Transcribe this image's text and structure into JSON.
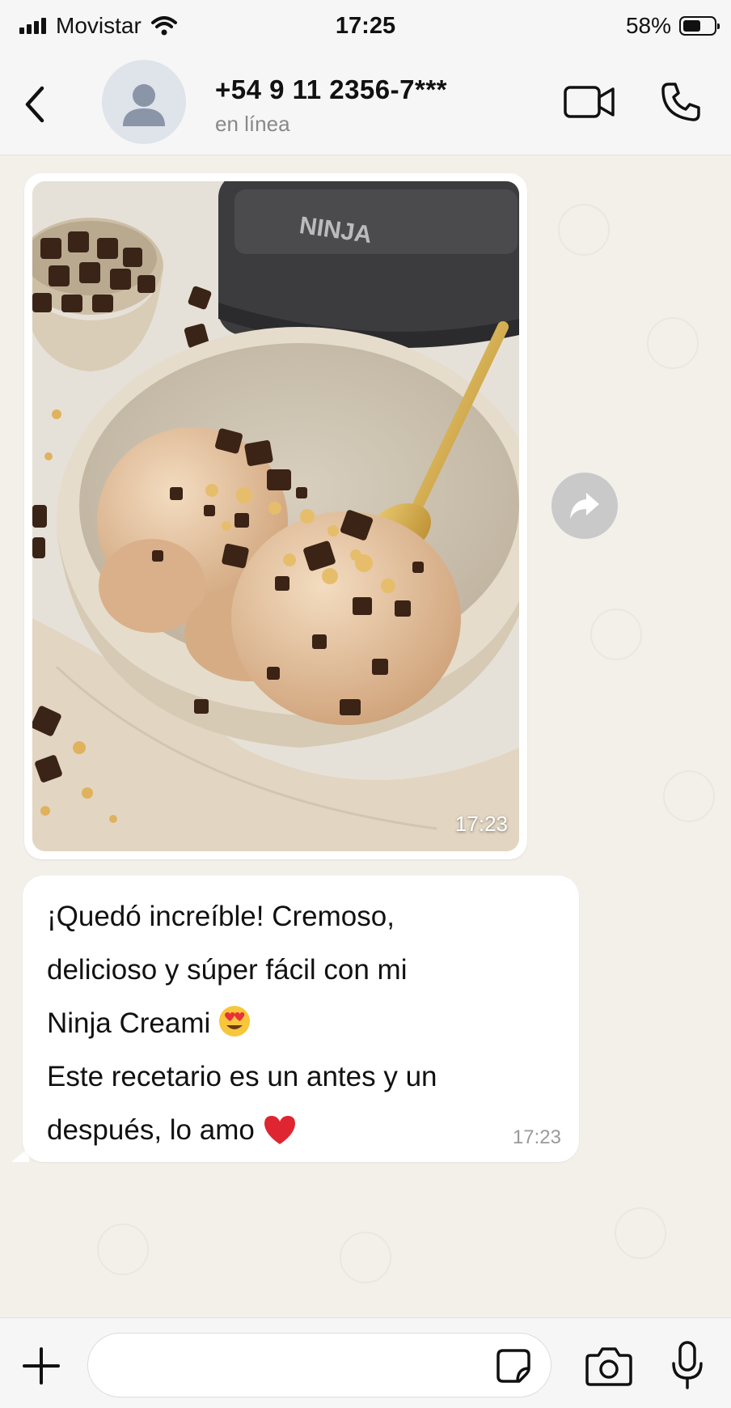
{
  "status_bar": {
    "carrier": "Movistar",
    "time": "17:25",
    "battery": "58%",
    "battery_level": 0.58
  },
  "header": {
    "contact_name": "+54 9 11 2356-7***",
    "contact_status": "en línea"
  },
  "image_message": {
    "time": "17:23",
    "brand_text": "NINJA"
  },
  "text_message": {
    "line1": "¡Quedó increíble! Cremoso,",
    "line2": "delicioso y súper fácil con mi",
    "line3": "Ninja Creami ",
    "line4": "Este recetario es un antes y un",
    "line5": "después, lo amo ",
    "time": "17:23"
  },
  "input": {
    "placeholder": ""
  },
  "icons": {
    "back": "chevron-left-icon",
    "avatar": "person-icon",
    "video": "video-camera-icon",
    "call": "phone-icon",
    "forward": "forward-arrow-icon",
    "plus": "plus-icon",
    "sticker": "sticker-icon",
    "camera": "camera-icon",
    "mic": "microphone-icon"
  },
  "colors": {
    "background": "#f3f0ea",
    "bubble": "#ffffff",
    "bar": "#f6f6f6"
  }
}
